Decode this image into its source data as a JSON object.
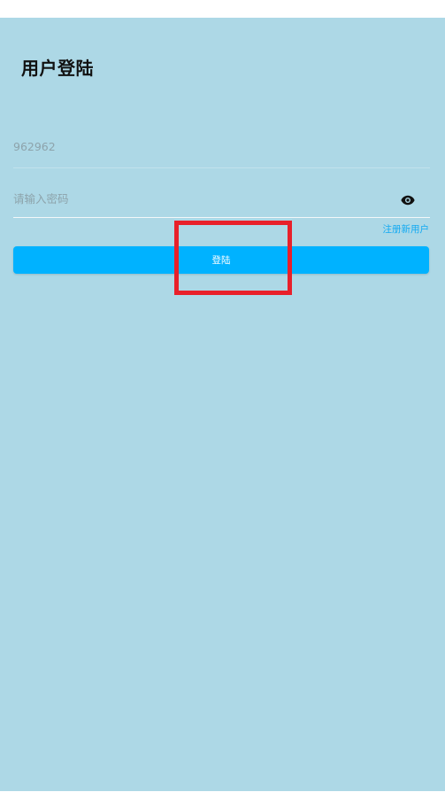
{
  "page": {
    "title": "用户登陆"
  },
  "form": {
    "username_value": "962962",
    "password_placeholder": "请输入密码",
    "register_label": "注册新用户",
    "login_label": "登陆"
  },
  "icons": {
    "password_toggle": "eye-icon"
  },
  "colors": {
    "background": "#add8e6",
    "button": "#00b2ff",
    "link": "#12aaf2",
    "highlight": "#e8202a"
  }
}
